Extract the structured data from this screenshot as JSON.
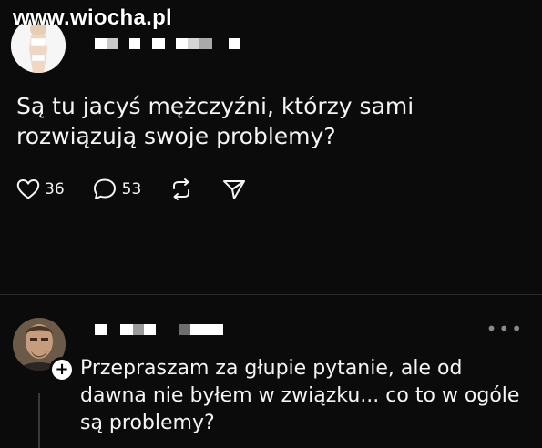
{
  "watermark": "www.wiocha.pl",
  "post": {
    "text": "Są tu jacyś mężczyźni, którzy sami rozwiązują swoje problemy?",
    "likes": "36",
    "comments": "53"
  },
  "reply": {
    "text": "Przepraszam za głupie pytanie, ale od dawna nie byłem w związku... co to w ogóle są problemy?",
    "more_label": "•••"
  },
  "colors": {
    "background": "#0b0b0b",
    "text": "#f5f5f5",
    "muted": "#8a8a8a",
    "divider": "#2d2d2d"
  },
  "icons": [
    "heart-icon",
    "comment-icon",
    "repost-icon",
    "share-icon",
    "more-icon",
    "add-icon"
  ]
}
